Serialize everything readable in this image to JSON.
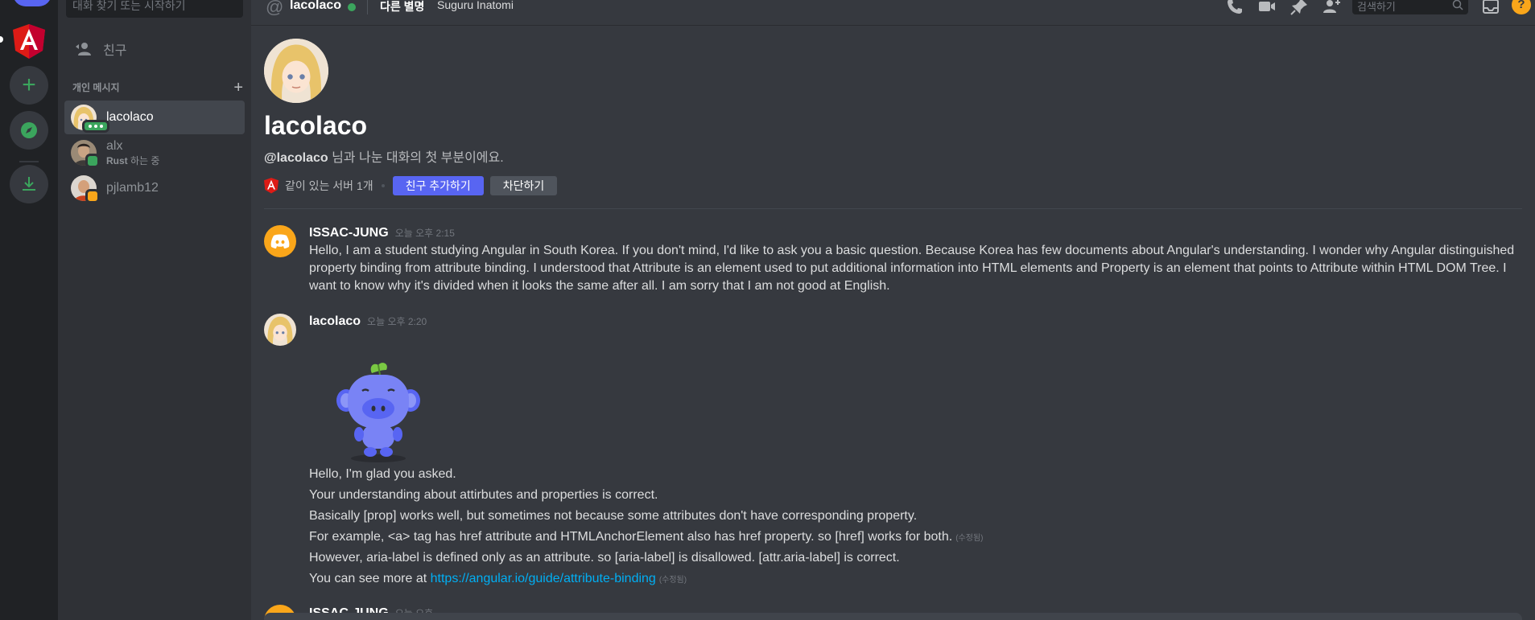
{
  "sidebar": {
    "search_placeholder": "대화 찾기 또는 시작하기",
    "friends_label": "친구",
    "dm_header": "개인 메시지",
    "dms": [
      {
        "name": "lacolaco",
        "status": "typing"
      },
      {
        "name": "alx",
        "activity_game": "Rust",
        "activity_suffix": " 하는 중",
        "status": "online"
      },
      {
        "name": "pjlamb12",
        "status": "idle"
      }
    ]
  },
  "header": {
    "channel_name": "lacolaco",
    "nickname_tag": "다른 별명",
    "nickname_value": "Suguru Inatomi",
    "search_placeholder": "검색하기"
  },
  "welcome": {
    "name": "lacolaco",
    "desc_handle": "@lacolaco",
    "desc_rest": " 님과 나눈 대화의 첫 부분이에요.",
    "mutual_servers": "같이 있는 서버 1개",
    "add_friend": "친구 추가하기",
    "block": "차단하기"
  },
  "messages": [
    {
      "author": "ISSAC-JUNG",
      "time": "오늘 오후 2:15",
      "text": "Hello, I am a student studying Angular in South Korea. If you don't mind, I'd like to ask you a basic question. Because Korea has few documents about Angular's understanding. I wonder why Angular distinguished property binding from attribute binding. I understood that Attribute is an element used to put additional information into HTML elements and Property is an element that points to Attribute within HTML DOM Tree. I want to know why it's divided when it looks the same after all. I am sorry that I am not good at English."
    },
    {
      "author": "lacolaco",
      "time": "오늘 오후 2:20",
      "lines": [
        "Hello, I'm glad you asked.",
        "Your understanding about attirbutes and properties is correct.",
        "Basically [prop] works well, but sometimes not because some attributes don't have corresponding property.",
        "For example, <a> tag has href attribute and HTMLAnchorElement also has href property. so [href] works for both.",
        "However, aria-label is defined only as an attribute. so [aria-label] is disallowed. [attr.aria-label] is correct.",
        "You can see more at "
      ],
      "link": "https://angular.io/guide/attribute-binding",
      "edited": "(수정됨)"
    },
    {
      "author": "ISSAC-JUNG",
      "time": "오늘 오후"
    }
  ],
  "colors": {
    "accent": "#5865f2",
    "online": "#3ba55d",
    "idle": "#faa61a",
    "link": "#00aff4",
    "angular_red": "#dd1b16"
  }
}
